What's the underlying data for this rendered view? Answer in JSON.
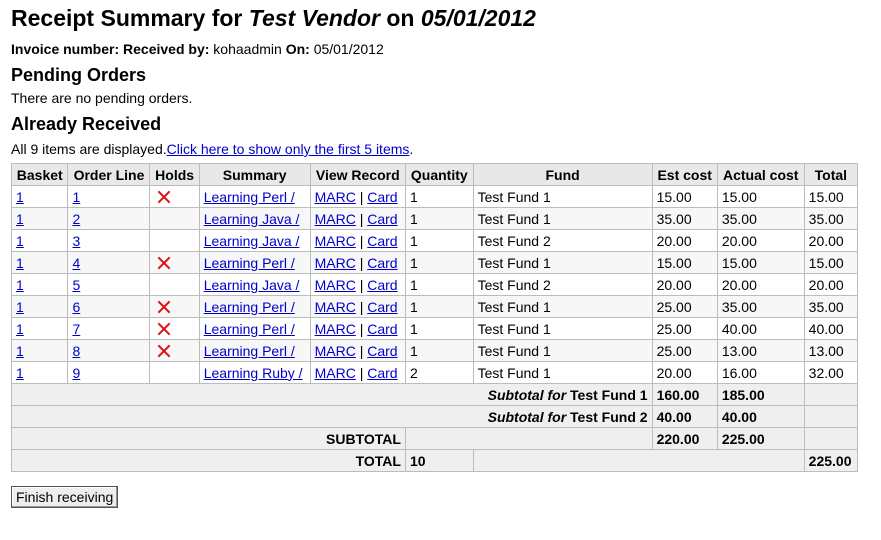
{
  "title": {
    "prefix": "Receipt Summary for ",
    "vendor": "Test Vendor",
    "on": " on ",
    "date": "05/01/2012"
  },
  "invoice": {
    "invoice_label": "Invoice number:",
    "received_by_label": "Received by:",
    "received_by": "kohaadmin",
    "on_label": "On:",
    "on_date": "05/01/2012"
  },
  "pending": {
    "heading": "Pending Orders",
    "message": "There are no pending orders."
  },
  "received": {
    "heading": "Already Received",
    "shown_text": "All 9 items are displayed.",
    "show_first_link": "Click here to show only the first 5 items",
    "period": "."
  },
  "table": {
    "headers": [
      "Basket",
      "Order Line",
      "Holds",
      "Summary",
      "View Record",
      "Quantity",
      "Fund",
      "Est cost",
      "Actual cost",
      "Total"
    ],
    "marc_label": "MARC",
    "sep": " | ",
    "card_label": "Card",
    "rows": [
      {
        "basket": "1",
        "order_line": "1",
        "hold": true,
        "summary": "Learning Perl /",
        "quantity": "1",
        "fund": "Test Fund 1",
        "est": "15.00",
        "actual": "15.00",
        "total": "15.00"
      },
      {
        "basket": "1",
        "order_line": "2",
        "hold": false,
        "summary": "Learning Java /",
        "quantity": "1",
        "fund": "Test Fund 1",
        "est": "35.00",
        "actual": "35.00",
        "total": "35.00"
      },
      {
        "basket": "1",
        "order_line": "3",
        "hold": false,
        "summary": "Learning Java /",
        "quantity": "1",
        "fund": "Test Fund 2",
        "est": "20.00",
        "actual": "20.00",
        "total": "20.00"
      },
      {
        "basket": "1",
        "order_line": "4",
        "hold": true,
        "summary": "Learning Perl /",
        "quantity": "1",
        "fund": "Test Fund 1",
        "est": "15.00",
        "actual": "15.00",
        "total": "15.00"
      },
      {
        "basket": "1",
        "order_line": "5",
        "hold": false,
        "summary": "Learning Java /",
        "quantity": "1",
        "fund": "Test Fund 2",
        "est": "20.00",
        "actual": "20.00",
        "total": "20.00"
      },
      {
        "basket": "1",
        "order_line": "6",
        "hold": true,
        "summary": "Learning Perl /",
        "quantity": "1",
        "fund": "Test Fund 1",
        "est": "25.00",
        "actual": "35.00",
        "total": "35.00"
      },
      {
        "basket": "1",
        "order_line": "7",
        "hold": true,
        "summary": "Learning Perl /",
        "quantity": "1",
        "fund": "Test Fund 1",
        "est": "25.00",
        "actual": "40.00",
        "total": "40.00"
      },
      {
        "basket": "1",
        "order_line": "8",
        "hold": true,
        "summary": "Learning Perl /",
        "quantity": "1",
        "fund": "Test Fund 1",
        "est": "25.00",
        "actual": "13.00",
        "total": "13.00"
      },
      {
        "basket": "1",
        "order_line": "9",
        "hold": false,
        "summary": "Learning Ruby /",
        "quantity": "2",
        "fund": "Test Fund 1",
        "est": "20.00",
        "actual": "16.00",
        "total": "32.00"
      }
    ],
    "subtotals": [
      {
        "label_em": "Subtotal for",
        "fund": "Test Fund 1",
        "est": "160.00",
        "actual": "185.00"
      },
      {
        "label_em": "Subtotal for",
        "fund": "Test Fund 2",
        "est": "40.00",
        "actual": "40.00"
      }
    ],
    "subtotal_label": "SUBTOTAL",
    "subtotal_est": "220.00",
    "subtotal_actual": "225.00",
    "total_label": "TOTAL",
    "total_quantity": "10",
    "total_value": "225.00"
  },
  "finish_button": "Finish receiving",
  "colors": {
    "link": "#0000cc",
    "hold_icon": "#dd1111",
    "header_bg": "#e8e8e8"
  },
  "icons": {
    "hold": "red-x-icon"
  }
}
